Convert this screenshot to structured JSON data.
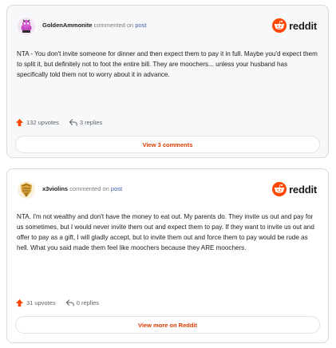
{
  "comments": [
    {
      "username": "GoldenAmmonite",
      "commented_text": "commented on",
      "post_link": "post",
      "brand": "reddit",
      "avatar_icon": "snoo-avatar-pink",
      "body": [
        "NTA - You don't invite someone for dinner and then expect them to pay it in full. Maybe you'd expect them to split it, but definitely not to foot the entire bill. They are moochers... unless your husband has specifically told them not to worry about it in advance."
      ],
      "upvotes": "132 upvotes",
      "replies": "3 replies",
      "action_label": "View 3 comments"
    },
    {
      "username": "x3violins",
      "commented_text": "commented on",
      "post_link": "post",
      "brand": "reddit",
      "avatar_icon": "snoo-avatar-gold",
      "body": [
        "NTA. I'm not wealthy and don't have the money to eat out. My parents do. They invite us out and pay for us sometimes, but I would never invite them out and expect them to pay. If they want to invite us out and offer to pay as a gift, I will gladly accept, but to invite them out and force them to pay would be rude as hell. What you said made them feel like moochers because they ARE moochers."
      ],
      "upvotes": "31 upvotes",
      "replies": "0 replies",
      "action_label": "View more on Reddit"
    }
  ],
  "colors": {
    "brand_orange": "#ff4500",
    "upvote_orange": "#ff4500",
    "link_blue": "#3b5ea7",
    "action_text": "#d93a00"
  }
}
